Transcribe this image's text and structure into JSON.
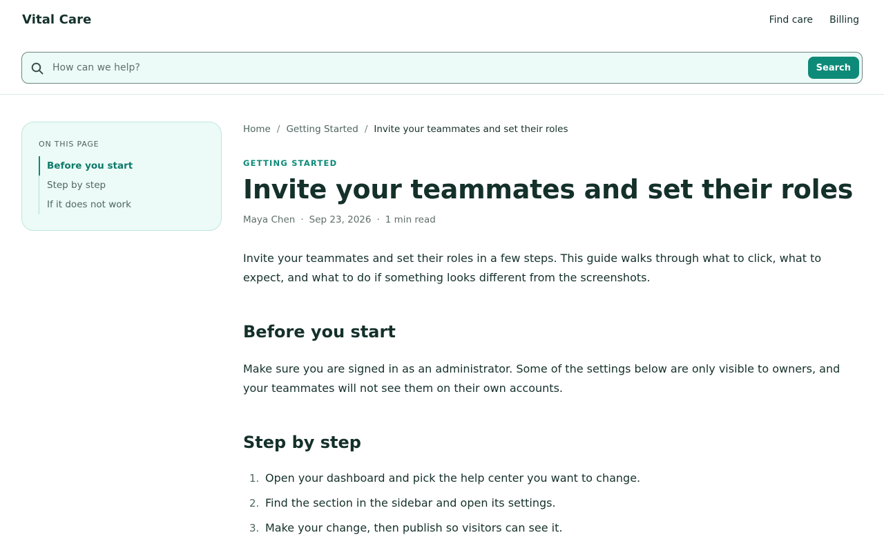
{
  "header": {
    "brand": "Vital Care",
    "nav": [
      "Find care",
      "Billing"
    ]
  },
  "search": {
    "placeholder": "How can we help?",
    "value": "",
    "button_label": "Search"
  },
  "toc": {
    "heading": "ON THIS PAGE",
    "items": [
      "Before you start",
      "Step by step",
      "If it does not work"
    ],
    "active_index": 0
  },
  "breadcrumb": {
    "items": [
      "Home",
      "Getting Started"
    ],
    "current": "Invite your teammates and set their roles"
  },
  "article": {
    "category": "GETTING STARTED",
    "title": "Invite your teammates and set their roles",
    "author": "Maya Chen",
    "date": "Sep 23, 2026",
    "read_time": "1 min read",
    "intro": "Invite your teammates and set their roles in a few steps. This guide walks through what to click, what to expect, and what to do if something looks different from the screenshots.",
    "sections": [
      {
        "heading": "Before you start",
        "body": "Make sure you are signed in as an administrator. Some of the settings below are only visible to owners, and your teammates will not see them on their own accounts."
      },
      {
        "heading": "Step by step",
        "steps": [
          "Open your dashboard and pick the help center you want to change.",
          "Find the section in the sidebar and open its settings.",
          "Make your change, then publish so visitors can see it."
        ]
      }
    ]
  },
  "colors": {
    "accent": "#0d8a78",
    "text": "#14302a",
    "muted": "#5f6f6b",
    "panel": "#ecfbf7"
  }
}
